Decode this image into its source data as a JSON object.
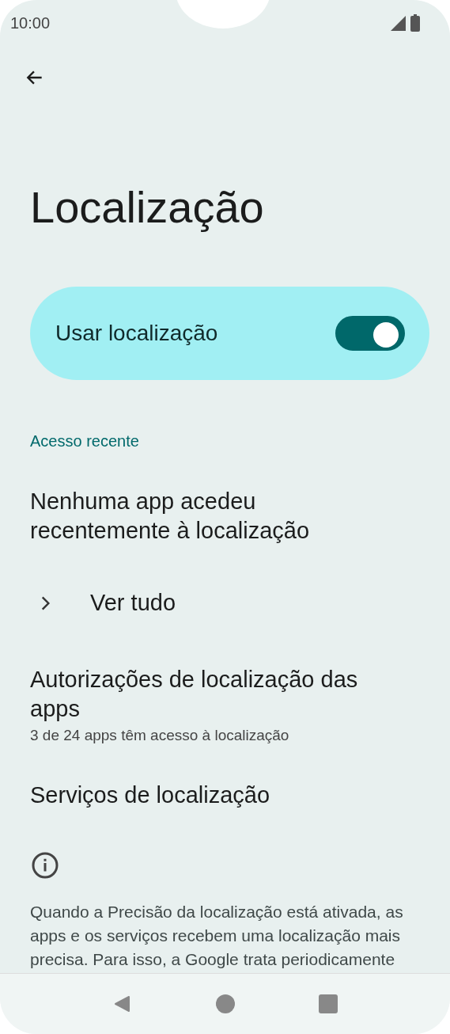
{
  "status_bar": {
    "time": "10:00"
  },
  "title": "Localização",
  "main_switch": {
    "label": "Usar localização",
    "on": true
  },
  "section_header": "Acesso recente",
  "items": [
    {
      "kind": "text",
      "title": "Nenhuma app acedeu recentemente à localização"
    },
    {
      "kind": "expand",
      "title": "Ver tudo"
    },
    {
      "kind": "text",
      "title": "Autorizações de localização das apps",
      "summary": "3 de 24 apps têm acesso à localização"
    },
    {
      "kind": "text",
      "title": "Serviços de localização"
    }
  ],
  "footer_info": "Quando a Precisão da localização está ativada, as apps e os serviços recebem uma localização mais precisa. Para isso, a Google trata periodicamente"
}
